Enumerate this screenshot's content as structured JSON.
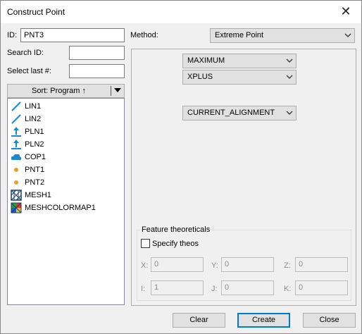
{
  "window": {
    "title": "Construct Point",
    "close_glyph": "✕"
  },
  "id_field": {
    "label": "ID:",
    "value": "PNT3"
  },
  "search_id": {
    "label": "Search ID:",
    "value": ""
  },
  "select_last": {
    "label": "Select last #:",
    "value": ""
  },
  "sort_button": {
    "label": "Sort: Program ↑"
  },
  "features": [
    {
      "name": "LIN1",
      "icon": "line-icon"
    },
    {
      "name": "LIN2",
      "icon": "line-icon"
    },
    {
      "name": "PLN1",
      "icon": "plane-icon"
    },
    {
      "name": "PLN2",
      "icon": "plane-icon"
    },
    {
      "name": "COP1",
      "icon": "point-cloud-icon"
    },
    {
      "name": "PNT1",
      "icon": "point-icon"
    },
    {
      "name": "PNT2",
      "icon": "point-icon"
    },
    {
      "name": "MESH1",
      "icon": "mesh-icon"
    },
    {
      "name": "MESHCOLORMAP1",
      "icon": "color-map-icon"
    }
  ],
  "method": {
    "label": "Method:",
    "value": "Extreme Point"
  },
  "options": {
    "direction_mode": "MAXIMUM",
    "axis": "XPLUS",
    "alignment": "CURRENT_ALIGNMENT"
  },
  "theoreticals": {
    "title": "Feature theoreticals",
    "specify_label": "Specify theos",
    "specify_checked": false,
    "x": {
      "label": "X:",
      "value": "0"
    },
    "y": {
      "label": "Y:",
      "value": "0"
    },
    "z": {
      "label": "Z:",
      "value": "0"
    },
    "i": {
      "label": "I:",
      "value": "1"
    },
    "j": {
      "label": "J:",
      "value": "0"
    },
    "k": {
      "label": "K:",
      "value": "0"
    }
  },
  "buttons": {
    "clear": "Clear",
    "create": "Create",
    "close": "Close"
  },
  "colors": {
    "accent": "#0078d7",
    "icon_blue": "#1e88c8",
    "point_orange": "#e8a030"
  }
}
